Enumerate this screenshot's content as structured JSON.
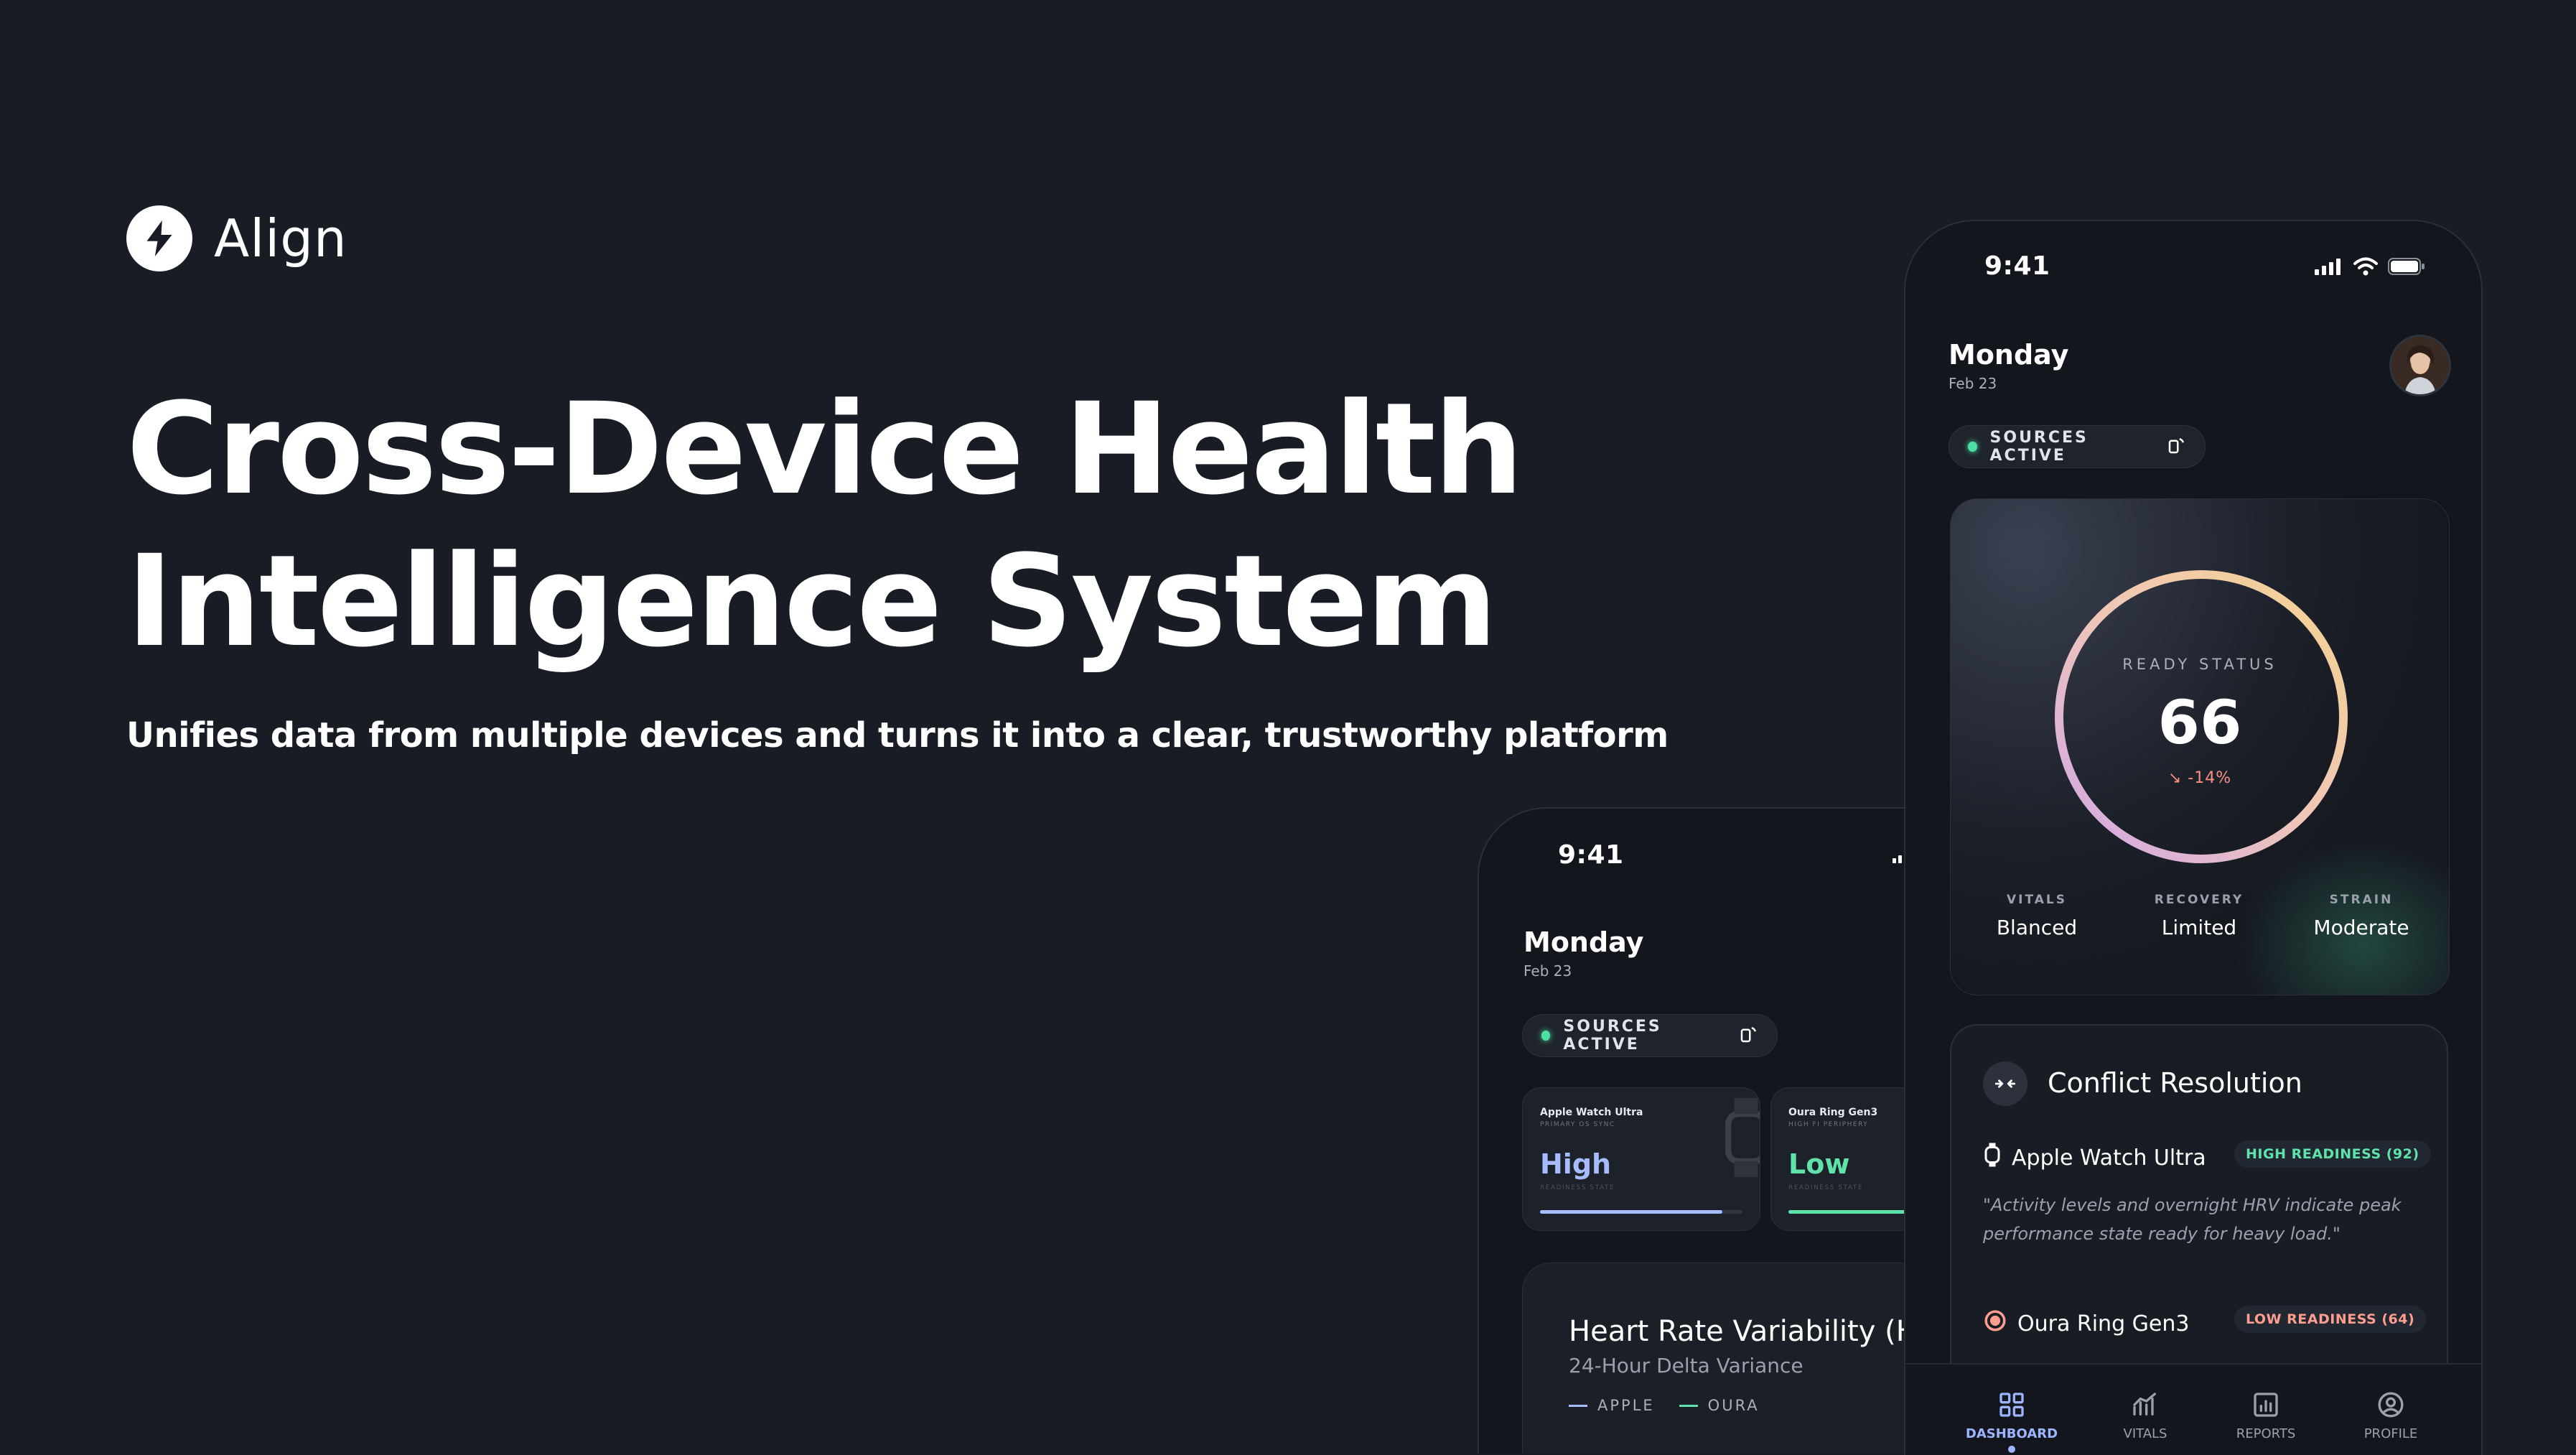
{
  "brand": {
    "name": "Align",
    "icon": "lightning-bolt-icon"
  },
  "hero": {
    "title_line1": "Cross-Device Health",
    "title_line2": "Intelligence System",
    "subtitle": "Unifies data from multiple devices and turns it into a clear, trustworthy platform"
  },
  "front_phone": {
    "status_time": "9:41",
    "day": "Monday",
    "date": "Feb 23",
    "sources_label": "SOURCES ACTIVE",
    "ready": {
      "label": "READY STATUS",
      "value": "66",
      "delta": "↘ -14%",
      "metrics": [
        {
          "label": "VITALS",
          "value": "Blanced"
        },
        {
          "label": "RECOVERY",
          "value": "Limited"
        },
        {
          "label": "STRAIN",
          "value": "Moderate"
        }
      ]
    },
    "conflict": {
      "title": "Conflict Resolution",
      "device1": {
        "name": "Apple Watch Ultra",
        "badge": "HIGH READINESS (92)"
      },
      "quote": "\"Activity levels and overnight HRV indicate peak performance state ready for heavy load.\"",
      "device2": {
        "name": "Oura Ring Gen3",
        "badge": "LOW READINESS (64)"
      }
    },
    "nav": [
      {
        "label": "DASHBOARD",
        "icon": "grid-icon",
        "active": true
      },
      {
        "label": "VITALS",
        "icon": "activity-chart-icon"
      },
      {
        "label": "REPORTS",
        "icon": "report-chart-icon"
      },
      {
        "label": "PROFILE",
        "icon": "user-circle-icon"
      }
    ]
  },
  "back_phone": {
    "status_time": "9:41",
    "day": "Monday",
    "date": "Feb 23",
    "sources_label": "SOURCES ACTIVE",
    "cards": [
      {
        "name": "Apple Watch Ultra",
        "sub": "PRIMARY OS SYNC",
        "value": "High",
        "caption": "READINESS STATE",
        "progress": 0.9
      },
      {
        "name": "Oura Ring Gen3",
        "sub": "HIGH FI PERIPHERY",
        "value": "Low",
        "caption": "READINESS STATE",
        "progress": 0.6
      }
    ],
    "hrv": {
      "title": "Heart Rate Variability (HRV)",
      "subtitle": "24-Hour Delta Variance",
      "legend": [
        "APPLE",
        "OURA"
      ]
    }
  },
  "colors": {
    "background": "#181c24",
    "accent_green": "#4ee0a2",
    "accent_blue": "#9db4ff",
    "accent_red": "#ff9d8f"
  }
}
